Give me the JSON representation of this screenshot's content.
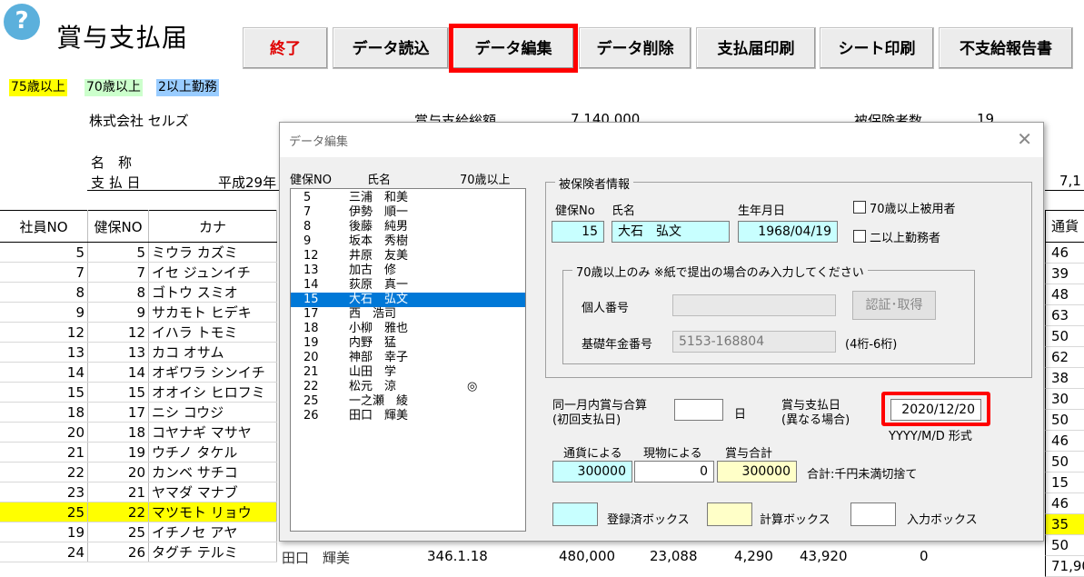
{
  "page": {
    "title": "賞与支払届",
    "help_icon": "?"
  },
  "toolbar": [
    {
      "label": "終了",
      "name": "exit-button"
    },
    {
      "label": "データ読込",
      "name": "data-load-button"
    },
    {
      "label": "データ編集",
      "name": "data-edit-button"
    },
    {
      "label": "データ削除",
      "name": "data-delete-button"
    },
    {
      "label": "支払届印刷",
      "name": "payment-print-button"
    },
    {
      "label": "シート印刷",
      "name": "sheet-print-button"
    },
    {
      "label": "不支給報告書",
      "name": "nonpayment-report-button"
    }
  ],
  "legend": {
    "age75": "75歳以上",
    "age70": "70歳以上",
    "multi": "2以上勤務",
    "colors": {
      "age75": "#ffff00",
      "age70": "#ccffcc",
      "multi": "#99ccff"
    }
  },
  "sheet": {
    "company": "株式会社 セルズ",
    "bonus_total_label": "賞与支給総額",
    "bonus_total_value": "7,140,000",
    "insured_count_label": "被保険者数",
    "insured_count_value": "19",
    "name_label": "名　称",
    "pay_date_label": "支 払 日",
    "pay_date_value": "平成29年",
    "right_partial": "7,1",
    "headers": {
      "emp_no": "社員NO",
      "ins_no": "健保NO",
      "kana": "カナ",
      "currency": "通貨"
    },
    "rows": [
      {
        "emp": "5",
        "ins": "5",
        "kana": "ミウラ カズミ",
        "cur": "46"
      },
      {
        "emp": "7",
        "ins": "7",
        "kana": "イセ ジュンイチ",
        "cur": "39"
      },
      {
        "emp": "8",
        "ins": "8",
        "kana": "ゴトウ スミオ",
        "cur": "48"
      },
      {
        "emp": "9",
        "ins": "9",
        "kana": "サカモト ヒデキ",
        "cur": "63"
      },
      {
        "emp": "12",
        "ins": "12",
        "kana": "イハラ トモミ",
        "cur": "50"
      },
      {
        "emp": "13",
        "ins": "13",
        "kana": "カコ オサム",
        "cur": "62"
      },
      {
        "emp": "14",
        "ins": "14",
        "kana": "オギワラ シンイチ",
        "cur": "38"
      },
      {
        "emp": "15",
        "ins": "15",
        "kana": "オオイシ ヒロフミ",
        "cur": "30"
      },
      {
        "emp": "18",
        "ins": "17",
        "kana": "ニシ コウジ",
        "cur": "50"
      },
      {
        "emp": "20",
        "ins": "18",
        "kana": "コヤナギ マサヤ",
        "cur": "46"
      },
      {
        "emp": "21",
        "ins": "19",
        "kana": "ウチノ タケル",
        "cur": "50"
      },
      {
        "emp": "22",
        "ins": "20",
        "kana": "カンベ サチコ",
        "cur": "15"
      },
      {
        "emp": "23",
        "ins": "21",
        "kana": "ヤマダ マナブ",
        "cur": "46"
      },
      {
        "emp": "25",
        "ins": "22",
        "kana": "マツモト リョウ",
        "cur": "35",
        "yellow": true
      },
      {
        "emp": "19",
        "ins": "25",
        "kana": "イチノセ アヤ",
        "cur": "50"
      },
      {
        "emp": "24",
        "ins": "26",
        "kana": "タグチ テルミ",
        "cur": "71,904"
      }
    ],
    "last_row_partial": {
      "name": "田口　輝美",
      "a": "346.1.18",
      "b": "480,000",
      "c": "23,088",
      "d": "4,290",
      "e": "43,920",
      "f": "0"
    }
  },
  "dialog": {
    "title": "データ編集",
    "close": "✕",
    "list_headers": {
      "ins": "健保NO",
      "name": "氏名",
      "age70": "70歳以上"
    },
    "list": [
      {
        "no": "5",
        "name": "三浦　和美"
      },
      {
        "no": "7",
        "name": "伊勢　順一"
      },
      {
        "no": "8",
        "name": "後藤　純男"
      },
      {
        "no": "9",
        "name": "坂本　秀樹"
      },
      {
        "no": "12",
        "name": "井原　友美"
      },
      {
        "no": "13",
        "name": "加古　修"
      },
      {
        "no": "14",
        "name": "荻原　真一"
      },
      {
        "no": "15",
        "name": "大石　弘文",
        "selected": true
      },
      {
        "no": "17",
        "name": "西　浩司"
      },
      {
        "no": "18",
        "name": "小柳　雅也"
      },
      {
        "no": "19",
        "name": "内野　猛"
      },
      {
        "no": "20",
        "name": "神部　幸子"
      },
      {
        "no": "21",
        "name": "山田　学"
      },
      {
        "no": "22",
        "name": "松元　涼",
        "mark": "◎"
      },
      {
        "no": "25",
        "name": "一之瀬　綾"
      },
      {
        "no": "26",
        "name": "田口　輝美"
      }
    ],
    "insured_group_title": "被保険者情報",
    "labels": {
      "ins_no": "健保No",
      "name": "氏名",
      "birth": "生年月日"
    },
    "values": {
      "ins_no": "15",
      "name": "大石　弘文",
      "birth": "1968/04/19"
    },
    "check_70": "70歳以上被用者",
    "check_multi": "二以上勤務者",
    "age70_group_title": "70歳以上のみ ※紙で提出の場合のみ入力してください",
    "personal_no_label": "個人番号",
    "personal_no_value": "",
    "auth_button": "認証･取得",
    "pension_no_label": "基礎年金番号",
    "pension_no_value": "5153-168804",
    "pension_hint": "(4桁-6桁)",
    "same_month_label1": "同一月内賞与合算",
    "same_month_label2": "(初回支払日)",
    "same_month_value": "",
    "day_unit": "日",
    "pay_date_label1": "賞与支払日",
    "pay_date_label2": "(異なる場合)",
    "pay_date_value": "2020/12/20",
    "date_format": "YYYY/M/D 形式",
    "currency_label": "通貨による",
    "kind_label": "現物による",
    "total_label": "賞与合計",
    "currency_value": "300000",
    "kind_value": "0",
    "total_value": "300000",
    "rounding_note": "合計:千円未満切捨て",
    "legend_registered": "登録済ボックス",
    "legend_calc": "計算ボックス",
    "legend_input": "入力ボックス"
  }
}
